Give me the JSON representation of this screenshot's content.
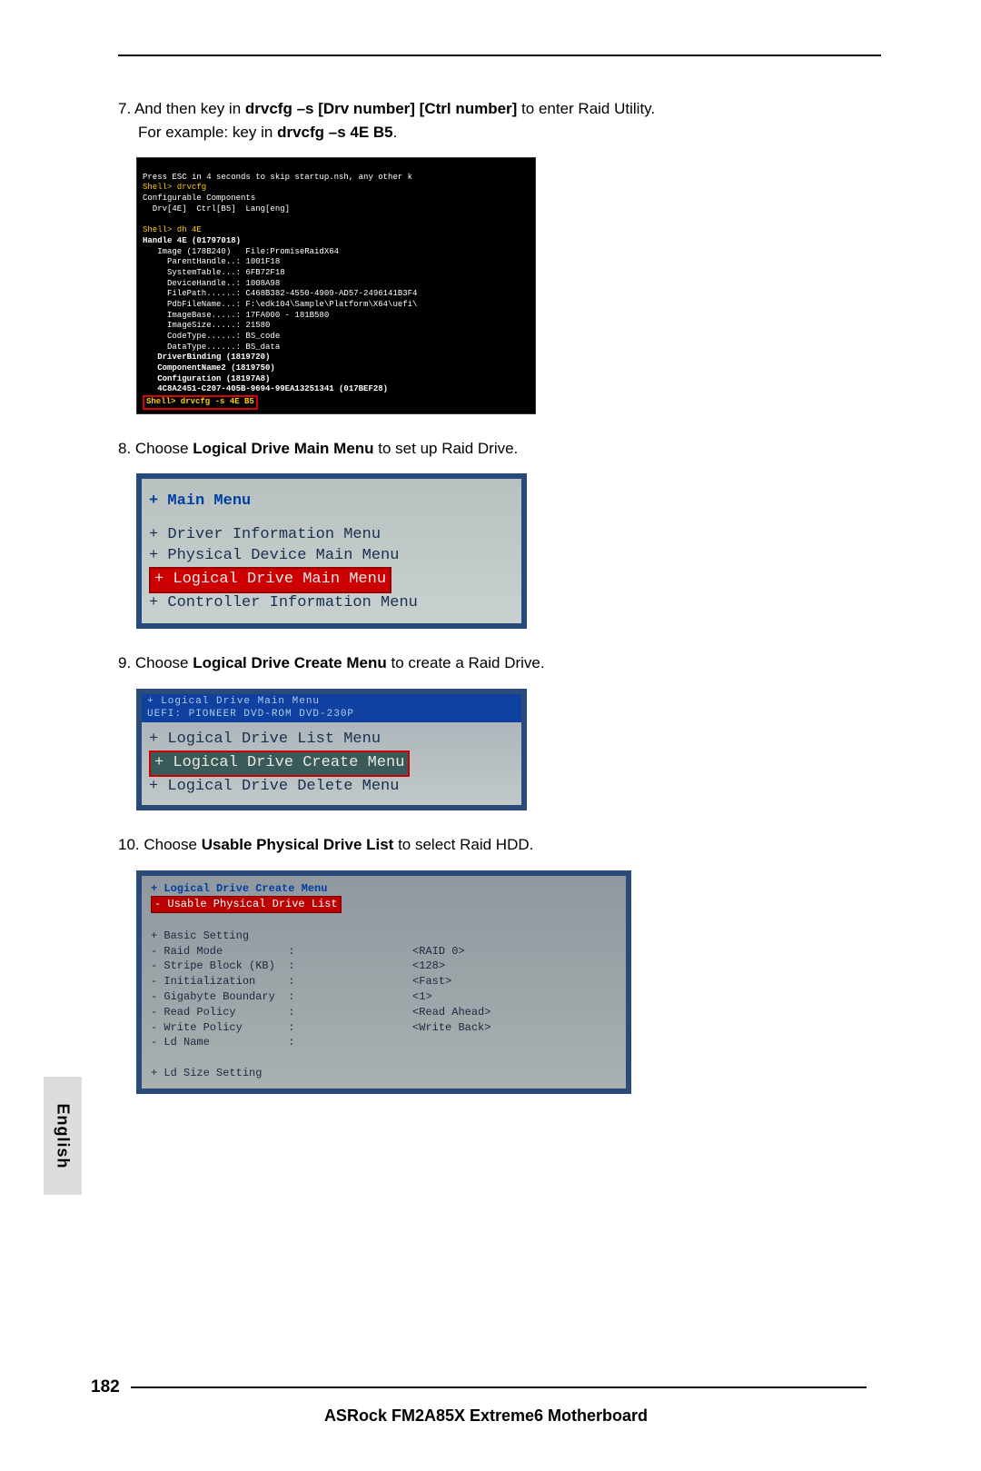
{
  "step7": {
    "prefix": "7. And then key in ",
    "bold1": "drvcfg –s [Drv number] [Ctrl number]",
    "mid": " to enter Raid Utility.",
    "line2a": "For example: key in ",
    "bold2": "drvcfg –s 4E B5",
    "line2b": "."
  },
  "terminal": {
    "l1": "Press ESC in 4 seconds to skip startup.nsh, any other k",
    "l2": "Shell> drvcfg",
    "l3": "Configurable Components",
    "l4": "  Drv[4E]  Ctrl[B5]  Lang[eng]",
    "l5": "Shell> dh 4E",
    "l6": "Handle 4E (01797018)",
    "l7": "   Image (178B240)   File:PromiseRaidX64",
    "l8": "     ParentHandle..: 1001F18",
    "l9": "     SystemTable...: 6FB72F18",
    "l10": "     DeviceHandle..: 1008A98",
    "l11": "     FilePath......: C468B382-4550-4909-AD57-2496141B3F4",
    "l12": "     PdbFileName...: F:\\edk104\\Sample\\Platform\\X64\\uefi\\",
    "l13": "     ImageBase.....: 17FA000 - 181B580",
    "l14": "     ImageSize.....: 21580",
    "l15": "     CodeType......: BS_code",
    "l16": "     DataType......: BS_data",
    "l17": "   DriverBinding (1819720)",
    "l18": "   ComponentName2 (1819750)",
    "l19": "   Configuration (18197A8)",
    "l20": "   4C8A2451-C207-405B-9694-99EA13251341 (017BEF28)",
    "l21": "Shell> drvcfg -s 4E B5"
  },
  "step8": {
    "prefix": "8. Choose ",
    "bold": "Logical Drive Main Menu",
    "suffix": " to set up Raid Drive."
  },
  "menu2": {
    "title": "+ Main Menu",
    "i1": "+ Driver Information Menu",
    "i2": "+ Physical Device Main Menu",
    "i3": "+ Logical Drive Main Menu",
    "i4": "+ Controller Information Menu"
  },
  "step9": {
    "prefix": "9. Choose ",
    "bold": "Logical Drive Create Menu",
    "suffix": " to create a Raid Drive."
  },
  "menu3": {
    "hdr": "+ Logical Drive Main Menu\nUEFI: PIONEER DVD-ROM DVD-230P",
    "i1": "+ Logical Drive List Menu",
    "i2": "+ Logical Drive Create Menu",
    "i3": "+ Logical Drive Delete Menu"
  },
  "step10": {
    "prefix": "10. Choose ",
    "bold": "Usable Physical Drive List",
    "suffix": " to select Raid HDD."
  },
  "menu4": {
    "title": "+ Logical Drive Create Menu",
    "hl": "- Usable Physical Drive List",
    "rows": [
      "+ Basic Setting",
      "- Raid Mode          :                  <RAID 0>",
      "- Stripe Block (KB)  :                  <128>",
      "- Initialization     :                  <Fast>",
      "- Gigabyte Boundary  :                  <1>",
      "- Read Policy        :                  <Read Ahead>",
      "- Write Policy       :                  <Write Back>",
      "- Ld Name            :",
      "",
      "+ Ld Size Setting"
    ]
  },
  "lang": "English",
  "page_number": "182",
  "product": "ASRock  FM2A85X Extreme6  Motherboard"
}
